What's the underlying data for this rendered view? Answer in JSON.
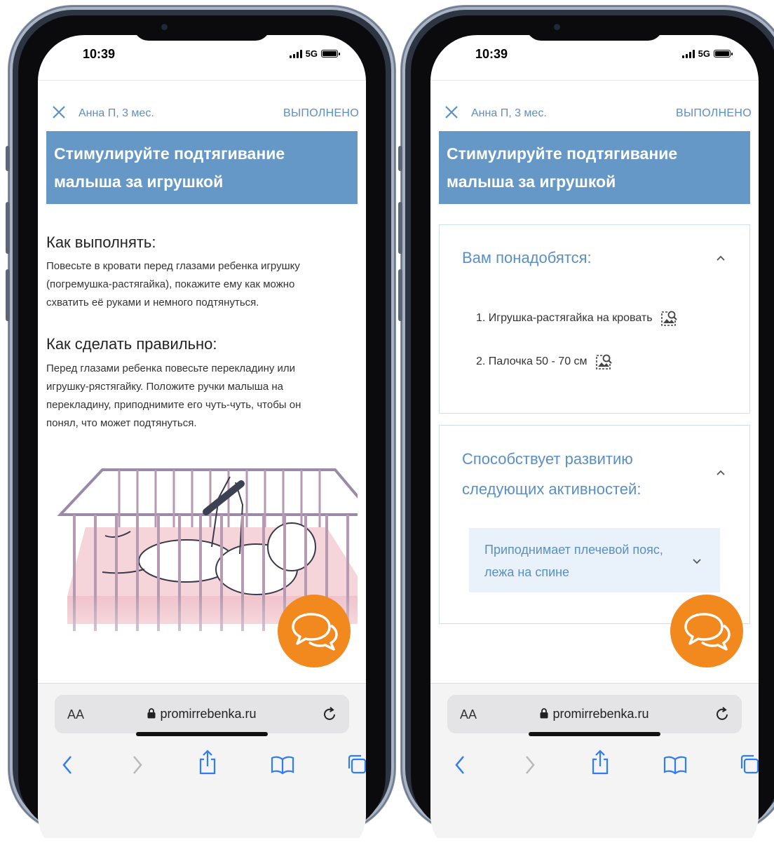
{
  "colors": {
    "accent": "#5a8fc3",
    "banner": "#6598c7",
    "chat": "#f2891f",
    "pale": "#e9f2fb",
    "card_border": "#cfe0ef"
  },
  "status": {
    "time": "10:39",
    "network": "5G"
  },
  "header": {
    "patient": "Анна П, 3 мес.",
    "done_label": "ВЫПОЛНЕНО",
    "title_line1": "Стимулируйте подтягивание",
    "title_line2": "малыша за игрушкой"
  },
  "howto": {
    "heading": "Как выполнять:",
    "text_lines": [
      "Повесьте в кровати перед глазами ребенка игрушку",
      "(погремушка-растягайка), покажите ему как можно",
      "схватить её руками и немного подтянуться."
    ]
  },
  "correct": {
    "heading": "Как сделать правильно:",
    "text_lines": [
      "Перед глазами ребенка повесьте перекладину или",
      "игрушку-рястягайку. Положите ручки малыша на",
      "перекладину, приподнимите его чуть-чуть, чтобы он",
      "понял, что может подтянуться."
    ]
  },
  "needs": {
    "title": "Вам понадобятся:",
    "items": [
      "1. Игрушка-растягайка на кровать",
      "2. Палочка 50 - 70 см"
    ]
  },
  "development": {
    "title_line1": "Способствует развитию",
    "title_line2": "следующих активностей:",
    "skill_line1": "Приподнимает плечевой пояс,",
    "skill_line2": "лежа на спине"
  },
  "browser": {
    "text_size_label": "AA",
    "url": "promirrebenka.ru"
  },
  "icons": [
    "close-icon",
    "chevron-up-icon",
    "chevron-down-icon",
    "image-search-icon",
    "chat-icon",
    "lock-icon",
    "reload-icon",
    "back-icon",
    "forward-icon",
    "share-icon",
    "bookmarks-icon",
    "tabs-icon"
  ]
}
